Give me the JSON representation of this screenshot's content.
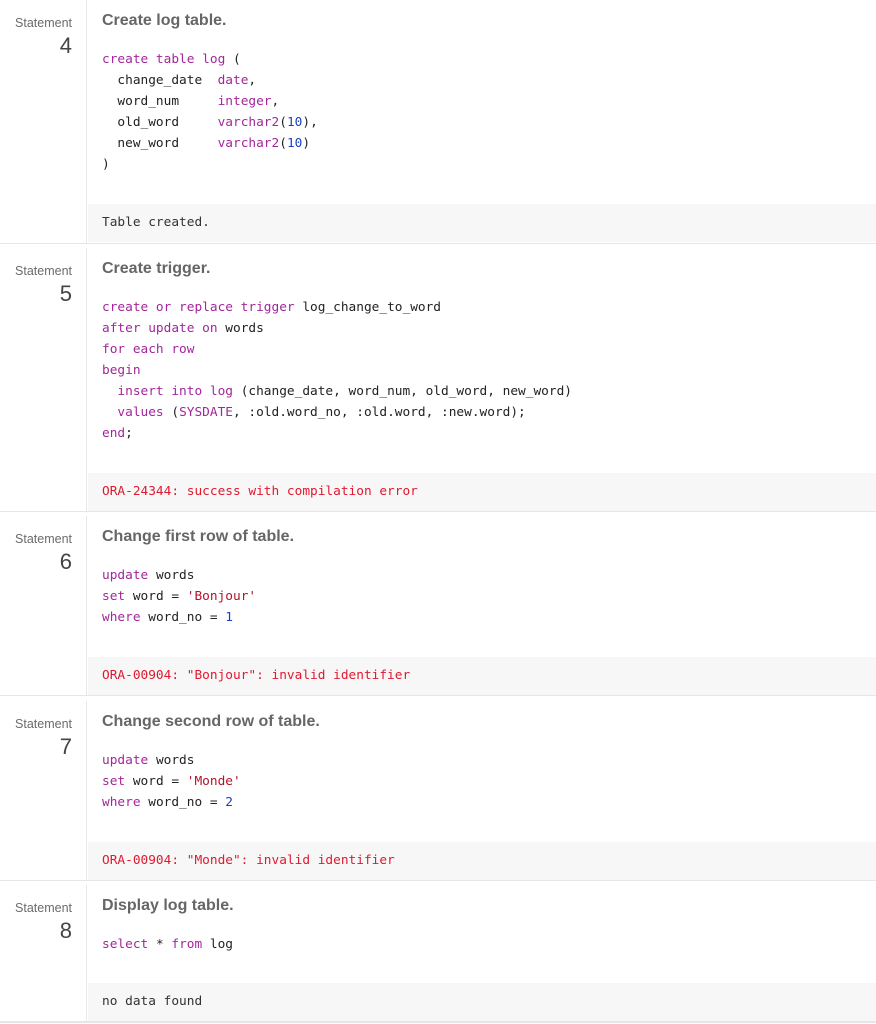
{
  "statements": [
    {
      "label": "Statement",
      "number": "4",
      "title": "Create log table.",
      "code": [
        [
          [
            "create table log",
            "kw"
          ],
          [
            " (",
            "txt"
          ]
        ],
        [
          [
            "  change_date  ",
            "txt"
          ],
          [
            "date",
            "kw"
          ],
          [
            ",",
            "txt"
          ]
        ],
        [
          [
            "  word_num     ",
            "txt"
          ],
          [
            "integer",
            "kw"
          ],
          [
            ",",
            "txt"
          ]
        ],
        [
          [
            "  old_word     ",
            "txt"
          ],
          [
            "varchar2",
            "kw"
          ],
          [
            "(",
            "txt"
          ],
          [
            "10",
            "num"
          ],
          [
            "),",
            "txt"
          ]
        ],
        [
          [
            "  new_word     ",
            "txt"
          ],
          [
            "varchar2",
            "kw"
          ],
          [
            "(",
            "txt"
          ],
          [
            "10",
            "num"
          ],
          [
            ")",
            "txt"
          ]
        ],
        [
          [
            ")",
            "txt"
          ]
        ]
      ],
      "result": "Table created.",
      "result_type": "info"
    },
    {
      "label": "Statement",
      "number": "5",
      "title": "Create trigger.",
      "code": [
        [
          [
            "create or replace trigger",
            "kw"
          ],
          [
            " log_change_to_word",
            "txt"
          ]
        ],
        [
          [
            "after update on",
            "kw"
          ],
          [
            " words",
            "txt"
          ]
        ],
        [
          [
            "for each row",
            "kw"
          ]
        ],
        [
          [
            "begin",
            "kw"
          ]
        ],
        [
          [
            "  insert into log",
            "kw"
          ],
          [
            " (change_date, word_num, old_word, new_word)",
            "txt"
          ]
        ],
        [
          [
            "  values",
            "kw"
          ],
          [
            " (",
            "txt"
          ],
          [
            "SYSDATE",
            "kw"
          ],
          [
            ", :old.word_no, :old.word, :new.word);",
            "txt"
          ]
        ],
        [
          [
            "end",
            "kw"
          ],
          [
            ";",
            "txt"
          ]
        ]
      ],
      "result": "ORA-24344: success with compilation error",
      "result_type": "error"
    },
    {
      "label": "Statement",
      "number": "6",
      "title": "Change first row of table.",
      "code": [
        [
          [
            "update",
            "kw"
          ],
          [
            " words",
            "txt"
          ]
        ],
        [
          [
            "set",
            "kw"
          ],
          [
            " word = ",
            "txt"
          ],
          [
            "'Bonjour'",
            "str"
          ]
        ],
        [
          [
            "where",
            "kw"
          ],
          [
            " word_no = ",
            "txt"
          ],
          [
            "1",
            "num"
          ]
        ]
      ],
      "result": "ORA-00904: \"Bonjour\": invalid identifier",
      "result_type": "error"
    },
    {
      "label": "Statement",
      "number": "7",
      "title": "Change second row of table.",
      "code": [
        [
          [
            "update",
            "kw"
          ],
          [
            " words",
            "txt"
          ]
        ],
        [
          [
            "set",
            "kw"
          ],
          [
            " word = ",
            "txt"
          ],
          [
            "'Monde'",
            "str"
          ]
        ],
        [
          [
            "where",
            "kw"
          ],
          [
            " word_no = ",
            "txt"
          ],
          [
            "2",
            "num"
          ]
        ]
      ],
      "result": "ORA-00904: \"Monde\": invalid identifier",
      "result_type": "error"
    },
    {
      "label": "Statement",
      "number": "8",
      "title": "Display log table.",
      "code": [
        [
          [
            "select",
            "kw"
          ],
          [
            " * ",
            "txt"
          ],
          [
            "from",
            "kw"
          ],
          [
            " log",
            "txt"
          ]
        ]
      ],
      "result": "no data found",
      "result_type": "info"
    }
  ],
  "colors": {
    "keyword": "#a3269b",
    "string": "#b3122b",
    "number": "#1b3fc2",
    "error": "#e0192f",
    "result_bg": "#f7f7f7"
  }
}
